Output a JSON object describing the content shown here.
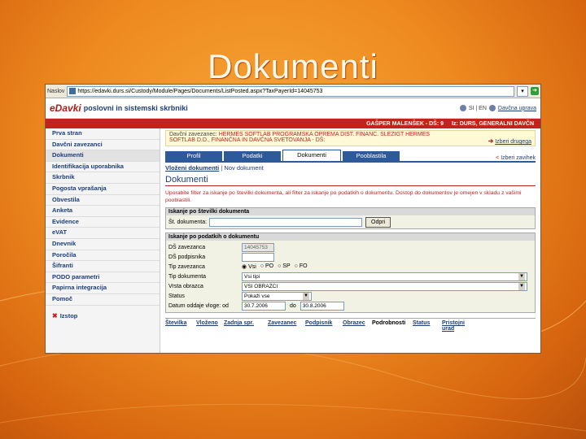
{
  "slide": {
    "title": "Dokumenti"
  },
  "browser": {
    "address_label": "Naslov",
    "url": "https://edavki.durs.si/Custody/Module/Pages/Documents/ListPosted.aspx?TaxPayerId=14045753",
    "go_label": "Pojdi"
  },
  "app": {
    "logo_mark": "eDavki",
    "logo_text": "poslovni in sistemski skrbniki",
    "lang": "SI | EN",
    "help_link": "Davčna uprava"
  },
  "redbar": {
    "user": "GAŠPER MALENŠEK - DŠ: 9",
    "org": "Iz: DURS, GENERALNI DAVČN"
  },
  "sidebar": {
    "items": [
      "Prva stran",
      "Davčni zavezanci",
      "Dokumenti",
      "Identifikacija uporabnika",
      "Skrbnik",
      "Pogosta vprašanja",
      "Obvestila",
      "Anketa",
      "Evidence",
      "eVAT",
      "Dnevnik",
      "Poročila",
      "Šifranti",
      "PODO parametri",
      "Papirna integracija",
      "Pomoč"
    ],
    "logout": "Izstop"
  },
  "taxpayer": {
    "label": "Davčni zavezanec:",
    "name": "HERMES SOFTLAB PROGRAMSKA OPREMA DIST. FINANC. SLEZIGT HERMES",
    "line2": "SOFTLAB D.D., FINANČNA IN DAVČNA SVETOVANJA - DŠ:",
    "other_link": "Izberi drugega"
  },
  "tabs": {
    "items": [
      "Profil",
      "Podatki",
      "Dokumenti",
      "Pooblastila"
    ],
    "active": 2,
    "choose_tab": "Izberi zavihek"
  },
  "subnav": {
    "active": "Vloženi dokumenti",
    "other": "Nov dokument"
  },
  "page": {
    "heading": "Dokumenti",
    "intro": "Uporabite filter za iskanje po številki dokumenta, ali filter za iskanje po podatkih o dokumentu. Dostop do dokumentov je omejen v skladu z vašimi pooblastili."
  },
  "search_number": {
    "title": "Iskanje po številki dokumenta",
    "label": "Št. dokumenta:",
    "button": "Odpri"
  },
  "search_data": {
    "title": "Iskanje po podatkih o dokumentu",
    "fields": {
      "taxpayer_label": "DŠ zavezanca",
      "taxpayer_value": "14045753",
      "signer_label": "DŠ podpisnika",
      "type_label": "Tip zavezanca",
      "type_options": [
        "Vsi",
        "PO",
        "SP",
        "FO"
      ],
      "doc_type_label": "Tip dokumenta",
      "doc_type_value": "Vsi tipi",
      "form_label": "Vrsta obrazca",
      "form_value": "VSI OBRAZCI",
      "status_label": "Status",
      "status_value": "Pokaži vse",
      "date_label": "Datum oddaje vloge: od",
      "date_from": "30.7.2006",
      "date_to_label": "do",
      "date_to": "30.8.2006"
    }
  },
  "results": {
    "columns": [
      "Številka",
      "Vloženo",
      "Zadnja spr.",
      "Zavezanec",
      "Podpisnik",
      "Obrazec",
      "Podrobnosti",
      "Status",
      "Pristojni urad"
    ]
  }
}
